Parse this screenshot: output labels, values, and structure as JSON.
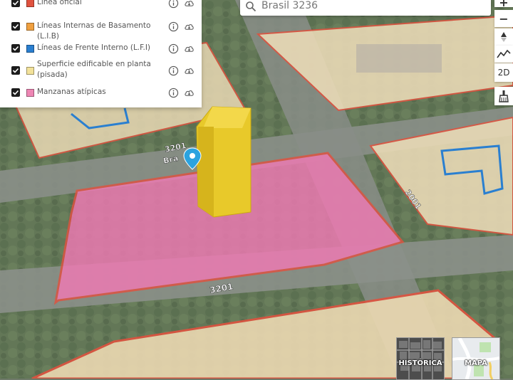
{
  "layers": [
    {
      "label": "Línea oficial",
      "color": "#e0523f",
      "checked": true
    },
    {
      "label": "Líneas Internas de Basamento (L.I.B)",
      "color": "#f0a040",
      "checked": true
    },
    {
      "label": "Líneas de Frente Interno (L.F.I)",
      "color": "#2a7fd0",
      "checked": true
    },
    {
      "label": "Superficie edificable en planta (pisada)",
      "color": "#f3e29a",
      "checked": true
    },
    {
      "label": "Manzanas atípicas",
      "color": "#ee86b4",
      "checked": true
    }
  ],
  "search": {
    "value": "Brasil 3236"
  },
  "controls": {
    "zoom_in": "+",
    "zoom_out": "−",
    "mode_2d": "2D"
  },
  "street_labels": {
    "top": "3201",
    "top_partial": "Bra",
    "right": "2001",
    "bottom": "3201"
  },
  "basemaps": {
    "historic": "HISTÓRICA",
    "map": "MAPA"
  },
  "icons": {
    "info": "info-icon",
    "download": "cloud-download-icon",
    "search": "search-icon",
    "compass": "compass-icon",
    "elevation": "elevation-profile-icon",
    "clear": "broom-icon",
    "marker": "location-pin-icon"
  }
}
